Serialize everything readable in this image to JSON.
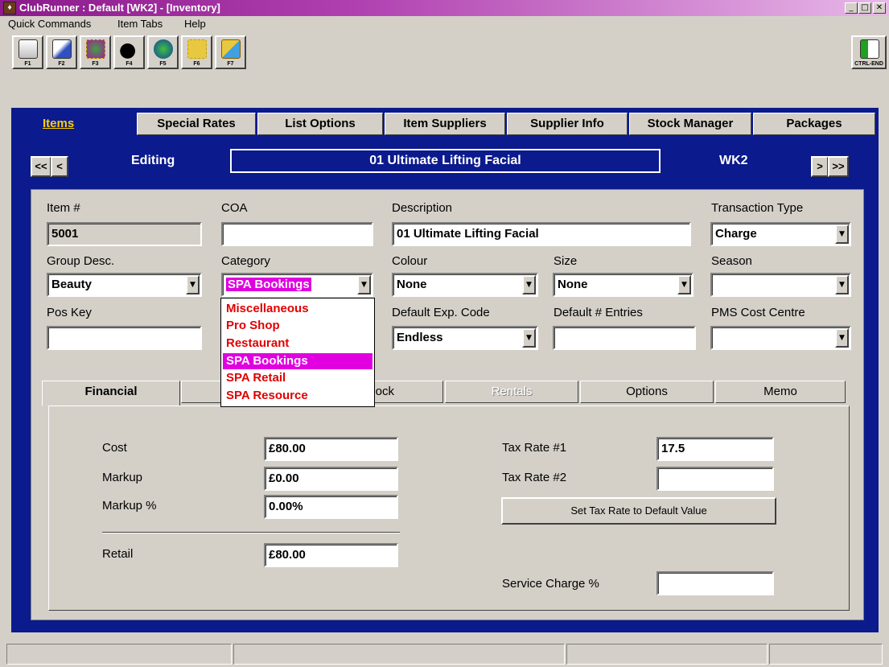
{
  "window": {
    "title": "ClubRunner : Default [WK2] - [Inventory]",
    "minimize_glyph": "_",
    "maximize_glyph": "□",
    "close_glyph": "✕"
  },
  "menu": [
    "Quick Commands",
    "Item Tabs",
    "Help"
  ],
  "toolbar": {
    "buttons": [
      {
        "key": "F1",
        "icon": "view-document-icon"
      },
      {
        "key": "F2",
        "icon": "edit-document-icon"
      },
      {
        "key": "F3",
        "icon": "package-list-icon"
      },
      {
        "key": "F4",
        "icon": "bomb-icon"
      },
      {
        "key": "F5",
        "icon": "globe-search-icon"
      },
      {
        "key": "F6",
        "icon": "box-icon"
      },
      {
        "key": "F7",
        "icon": "box-search-icon"
      }
    ],
    "exit_key": "CTRL-END",
    "exit_icon": "exit-door-icon"
  },
  "tabs": [
    "Items",
    "Special Rates",
    "List Options",
    "Item Suppliers",
    "Supplier Info",
    "Stock Manager",
    "Packages"
  ],
  "nav": {
    "first": "<<",
    "prev": "<",
    "next": ">",
    "last": ">>",
    "mode": "Editing",
    "item_name": "01 Ultimate Lifting Facial",
    "location": "WK2"
  },
  "form": {
    "item_no_label": "Item #",
    "item_no": "5001",
    "coa_label": "COA",
    "coa": "",
    "description_label": "Description",
    "description": "01 Ultimate Lifting Facial",
    "transaction_type_label": "Transaction Type",
    "transaction_type": "Charge",
    "group_desc_label": "Group Desc.",
    "group_desc": "Beauty",
    "category_label": "Category",
    "category": "SPA Bookings",
    "colour_label": "Colour",
    "colour": "None",
    "size_label": "Size",
    "size": "None",
    "season_label": "Season",
    "season": "",
    "pos_key_label": "Pos Key",
    "pos_key": "",
    "default_exp_code_label": "Default Exp. Code",
    "default_exp_code": "Endless",
    "default_entries_label": "Default # Entries",
    "default_entries": "",
    "pms_cost_centre_label": "PMS Cost Centre",
    "pms_cost_centre": ""
  },
  "category_options": [
    "Miscellaneous",
    "Pro Shop",
    "Restaurant",
    "SPA Bookings",
    "SPA Retail",
    "SPA Resource"
  ],
  "sub_tabs": [
    "Financial",
    "ock",
    "Rentals",
    "Options",
    "Memo"
  ],
  "financial": {
    "cost_label": "Cost",
    "cost": "£80.00",
    "markup_label": "Markup",
    "markup": "£0.00",
    "markup_pct_label": "Markup %",
    "markup_pct": "0.00%",
    "retail_label": "Retail",
    "retail": "£80.00",
    "tax1_label": "Tax Rate #1",
    "tax1": "17.5",
    "tax2_label": "Tax Rate #2",
    "tax2": "",
    "set_default_label": "Set Tax Rate to Default Value",
    "service_charge_label": "Service Charge %",
    "service_charge": ""
  },
  "colors": {
    "title_gradient_start": "#8b1a8b",
    "panel_blue": "#0b1a8c",
    "active_tab_text": "#ffd000",
    "dropdown_item_text": "#e00000",
    "selection_highlight": "#e000e0"
  }
}
